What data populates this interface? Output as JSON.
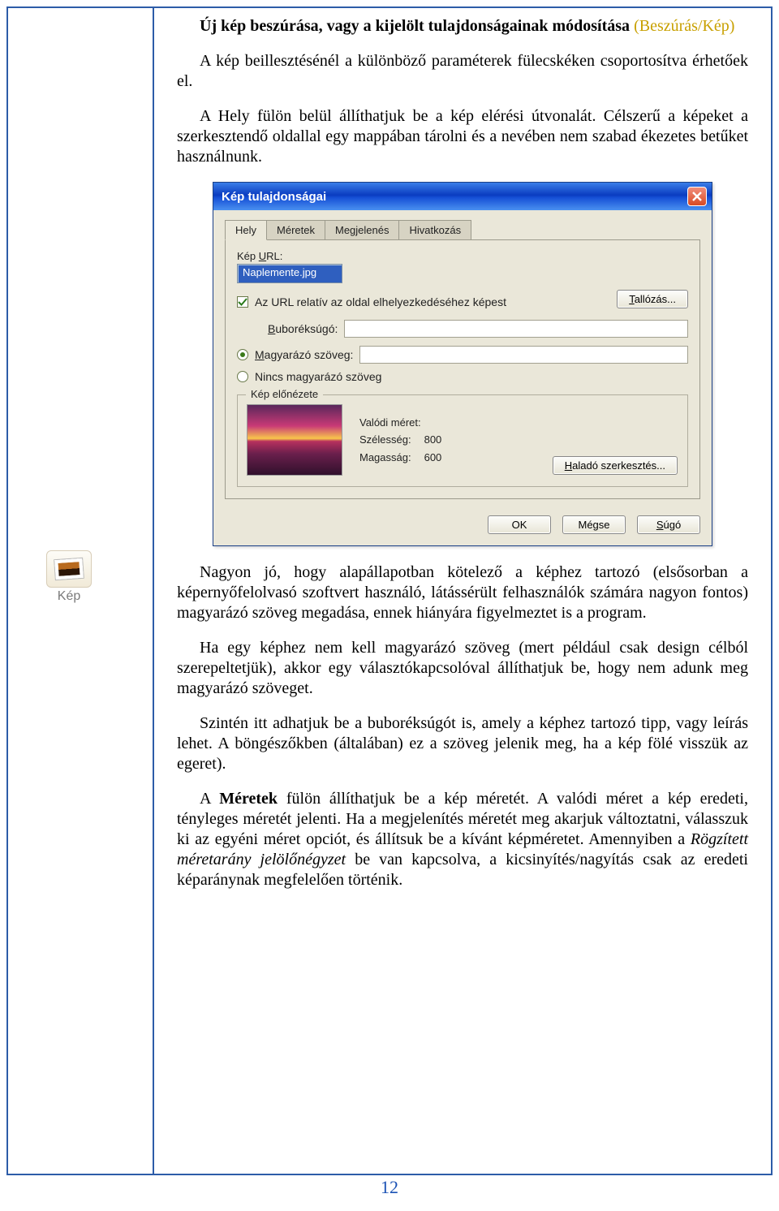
{
  "doc": {
    "title_bold": "Új kép beszúrása, vagy a kijelölt tulajdonságainak módosítása",
    "subtitle": "(Beszúrás/Kép)",
    "para1": "A kép beillesztésénél a különböző paraméterek fülecskéken csoportosítva érhetőek el.",
    "para2": "A Hely fülön belül állíthatjuk be a kép elérési útvonalát. Célszerű a képeket a szerkesztendő oldallal egy mappában tárolni és a nevében nem szabad ékezetes betűket használnunk.",
    "para3": "Nagyon jó, hogy alapállapotban kötelező a képhez tartozó (elsősorban a képernyőfelolvasó szoftvert használó, látássérült felhasználók számára nagyon fontos) magyarázó szöveg megadása, ennek hiányára figyelmeztet is a program.",
    "para4": "Ha egy képhez nem kell magyarázó szöveg (mert például csak design célból szerepeltetjük), akkor egy választókapcsolóval állíthatjuk be, hogy nem adunk meg magyarázó szöveget.",
    "para5": "Szintén itt adhatjuk be a buboréksúgót is, amely a képhez tartozó tipp, vagy leírás lehet. A böngészőkben (általában) ez a szöveg jelenik meg, ha a kép fölé visszük az egeret).",
    "para6_pre": "A ",
    "para6_bold": "Méretek",
    "para6_mid": " fülön állíthatjuk be a kép méretét. A valódi méret a kép eredeti, tényleges méretét jelenti. Ha a megjelenítés méretét meg akarjuk változtatni, válasszuk ki az egyéni méret opciót, és állítsuk be a kívánt képméretet. Amennyiben a ",
    "para6_italic": "Rögzített méretarány jelölőnégyzet",
    "para6_end": " be van kapcsolva, a kicsinyítés/nagyítás csak az eredeti képaránynak megfelelően történik.",
    "page_number": "12"
  },
  "kep_widget": {
    "label": "Kép"
  },
  "dialog": {
    "title": "Kép tulajdonságai",
    "tabs": {
      "t1": "Hely",
      "t2": "Méretek",
      "t3": "Megjelenés",
      "t4": "Hivatkozás"
    },
    "url_label_pre": "Kép ",
    "url_label_u": "U",
    "url_label_post": "RL:",
    "url_value": "Naplemente.jpg",
    "relative": "Az URL relatív az oldal elhelyezkedéséhez képest",
    "browse_u": "T",
    "browse_rest": "allózás...",
    "tooltip_u": "B",
    "tooltip_rest": "uboréksúgó:",
    "alt_u": "M",
    "alt_rest": "agyarázó szöveg:",
    "noalt": "Nincs magyarázó szöveg",
    "preview_legend": "Kép előnézete",
    "realsize": "Valódi méret:",
    "width_label": "Szélesség:",
    "width_val": "800",
    "height_label": "Magasság:",
    "height_val": "600",
    "adv_u": "H",
    "adv_rest": "aladó szerkesztés...",
    "ok": "OK",
    "cancel": "Mégse",
    "help_u": "S",
    "help_rest": "úgó"
  }
}
